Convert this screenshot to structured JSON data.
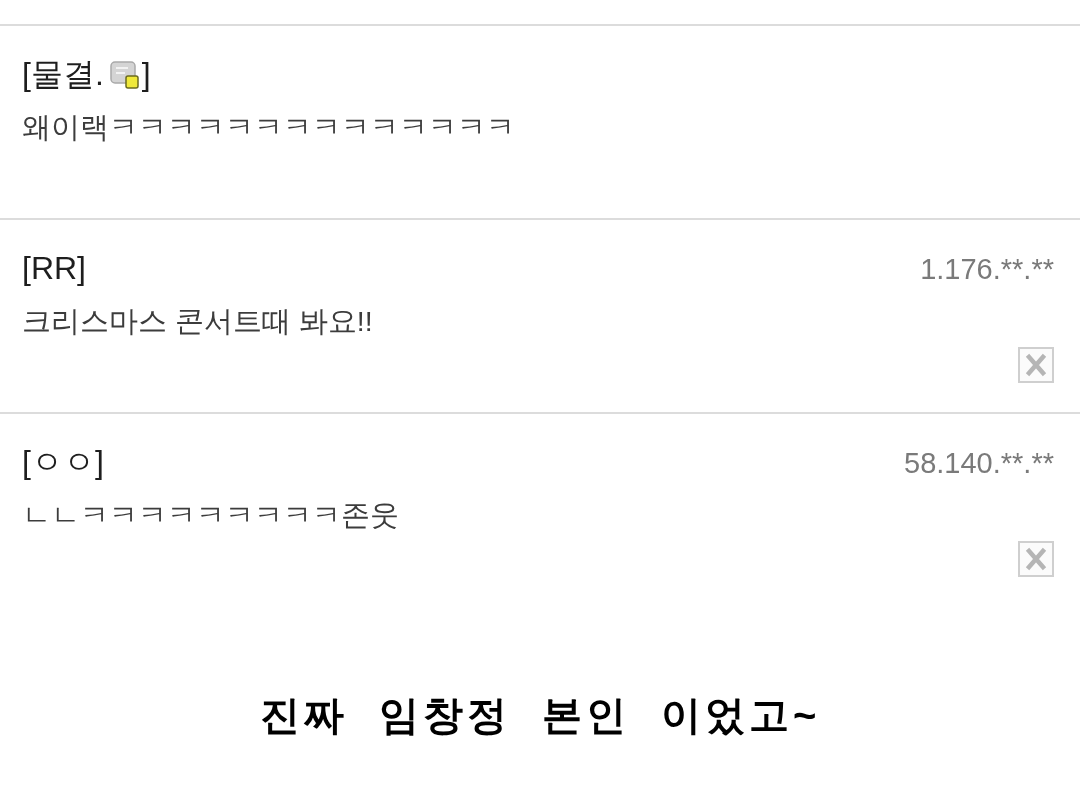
{
  "comments": [
    {
      "kind": "member",
      "author": "[물결.",
      "author_end": "]",
      "text": "왜이랙ㅋㅋㅋㅋㅋㅋㅋㅋㅋㅋㅋㅋㅋㅋ"
    },
    {
      "kind": "guest",
      "author": "[RR]",
      "ip": "1.176.**.**",
      "text": "크리스마스 콘서트때 봐요!!"
    },
    {
      "kind": "guest",
      "author": "[ㅇㅇ]",
      "ip": "58.140.**.**",
      "text": "ㄴㄴㅋㅋㅋㅋㅋㅋㅋㅋㅋ존웃"
    }
  ],
  "caption": "진짜 임창정 본인 이었고~"
}
